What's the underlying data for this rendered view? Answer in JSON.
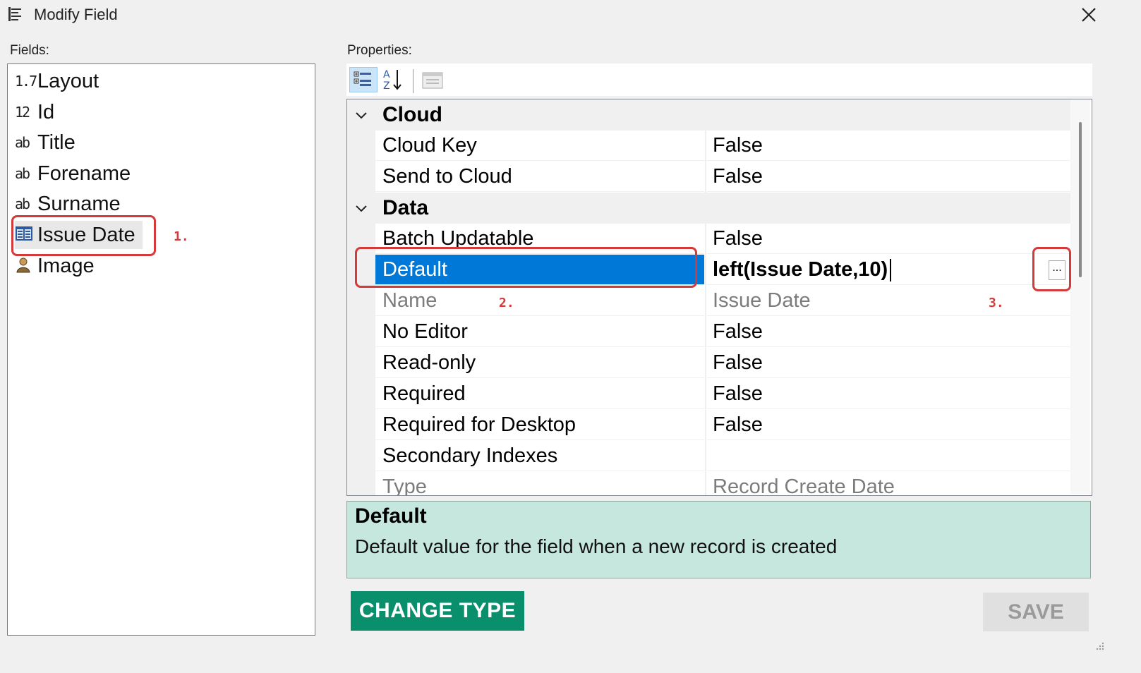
{
  "window": {
    "title": "Modify Field"
  },
  "fields": {
    "label": "Fields:",
    "items": [
      {
        "icon_text": "1.7",
        "icon": "decimal-number-icon",
        "label": "Layout"
      },
      {
        "icon_text": "12",
        "icon": "integer-number-icon",
        "label": "Id"
      },
      {
        "icon_text": "ab",
        "icon": "text-field-icon",
        "label": "Title"
      },
      {
        "icon_text": "ab",
        "icon": "text-field-icon",
        "label": "Forename"
      },
      {
        "icon_text": "ab",
        "icon": "text-field-icon",
        "label": "Surname"
      },
      {
        "icon_text": "",
        "icon": "calendar-icon",
        "label": "Issue Date",
        "selected": true
      },
      {
        "icon_text": "",
        "icon": "person-image-icon",
        "label": "Image"
      }
    ]
  },
  "properties": {
    "label": "Properties:",
    "toolbar": [
      "categorized-view-icon",
      "alphabetical-sort-icon",
      "property-pages-icon"
    ],
    "categories": [
      {
        "name": "Cloud",
        "rows": [
          {
            "name": "Cloud Key",
            "value": "False"
          },
          {
            "name": "Send to Cloud",
            "value": "False"
          }
        ]
      },
      {
        "name": "Data",
        "rows": [
          {
            "name": "Batch Updatable",
            "value": "False"
          },
          {
            "name": "Default",
            "value": "left(Issue Date,10)",
            "selected": true,
            "editing": true
          },
          {
            "name": "Name",
            "value": "Issue Date",
            "readonly": true
          },
          {
            "name": "No Editor",
            "value": "False"
          },
          {
            "name": "Read-only",
            "value": "False"
          },
          {
            "name": "Required",
            "value": "False"
          },
          {
            "name": "Required for Desktop",
            "value": "False"
          },
          {
            "name": "Secondary Indexes",
            "value": ""
          },
          {
            "name": "Type",
            "value": "Record Create Date",
            "readonly": true
          }
        ]
      }
    ],
    "ellipsis_label": "..."
  },
  "description": {
    "title": "Default",
    "text": "Default value for the field when a new record is created",
    "bg_color": "#c6e7dd"
  },
  "buttons": {
    "change_type": "CHANGE TYPE",
    "save": "SAVE"
  },
  "annotations": [
    "1.",
    "2.",
    "3."
  ],
  "colors": {
    "selection": "#0078d7",
    "change_type_button": "#0a8f6c",
    "annotation": "#d43a3a"
  }
}
